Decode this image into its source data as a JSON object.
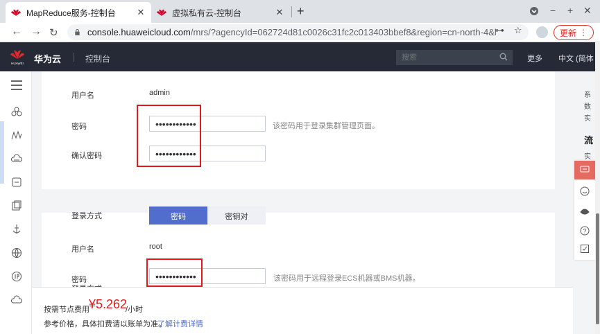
{
  "browser": {
    "tabs": [
      {
        "title": "MapReduce服务-控制台",
        "active": true
      },
      {
        "title": "虚拟私有云-控制台",
        "active": false
      }
    ],
    "url_host": "console.huaweicloud.com",
    "url_rest": "/mrs/?agencyId=062724d81c0026c31fc2c013403bbef8&region=cn-north-4&local⋯",
    "update_label": "更新",
    "new_tab": "+",
    "win_min": "−",
    "win_max": "+",
    "win_close": "✕"
  },
  "header": {
    "brand": "华为云",
    "logo_text": "HUAWEI",
    "console": "控制台",
    "search_placeholder": "搜索",
    "more": "更多",
    "language": "中文 (简体"
  },
  "cluster_account": {
    "username_label": "用户名",
    "username_value": "admin",
    "password_label": "密码",
    "password_mask": "••••••••••••",
    "password_hint": "该密码用于登录集群管理页面。",
    "confirm_label": "确认密码",
    "confirm_mask": "••••••••••••"
  },
  "node_login": {
    "method_label": "登录方式",
    "method_options": [
      "密码",
      "密钥对"
    ],
    "method_selected": "密码",
    "username_label": "用户名",
    "username_value": "root",
    "password_label": "密码",
    "password_mask": "••••••••••••",
    "password_hint": "该密码用于远程登录ECS机器或BMS机器。"
  },
  "footer": {
    "cost_label": "按需节点费用",
    "cost_value": "¥5.262",
    "cost_unit": "/小时",
    "reference_note": "参考价格，具体扣费请以账单为准。",
    "pricing_link": "了解计费详情"
  },
  "right_panel": {
    "lines": [
      "系",
      "数",
      "实"
    ],
    "heading": "流",
    "sub": "实"
  },
  "colors": {
    "header_bg": "#252a36",
    "accent_blue": "#526ecc",
    "price_red": "#e0191d",
    "annotation_red": "#e0191d"
  }
}
